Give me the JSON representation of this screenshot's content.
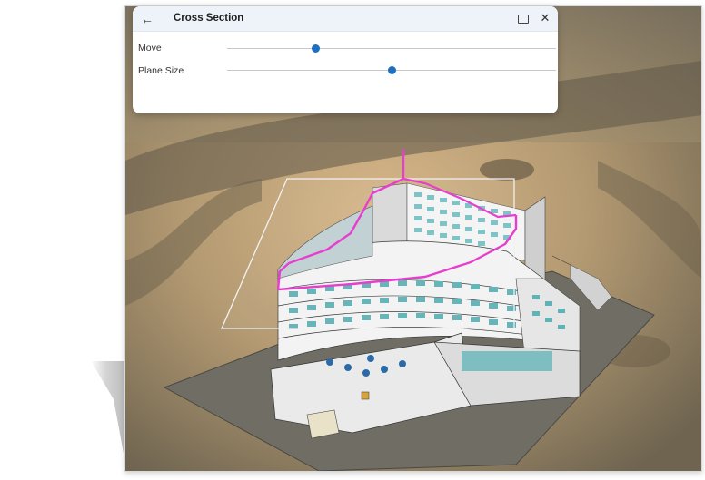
{
  "panel": {
    "title": "Cross Section",
    "back_icon": "arrow-left-icon",
    "maximize_icon": "maximize-icon",
    "close_icon": "close-icon"
  },
  "sliders": [
    {
      "label": "Move",
      "value_fraction": 0.27
    },
    {
      "label": "Plane Size",
      "value_fraction": 0.5
    }
  ],
  "colors": {
    "accent": "#1e6fbf",
    "section_outline": "#e83ecf",
    "titlebar": "#eef2f9"
  }
}
